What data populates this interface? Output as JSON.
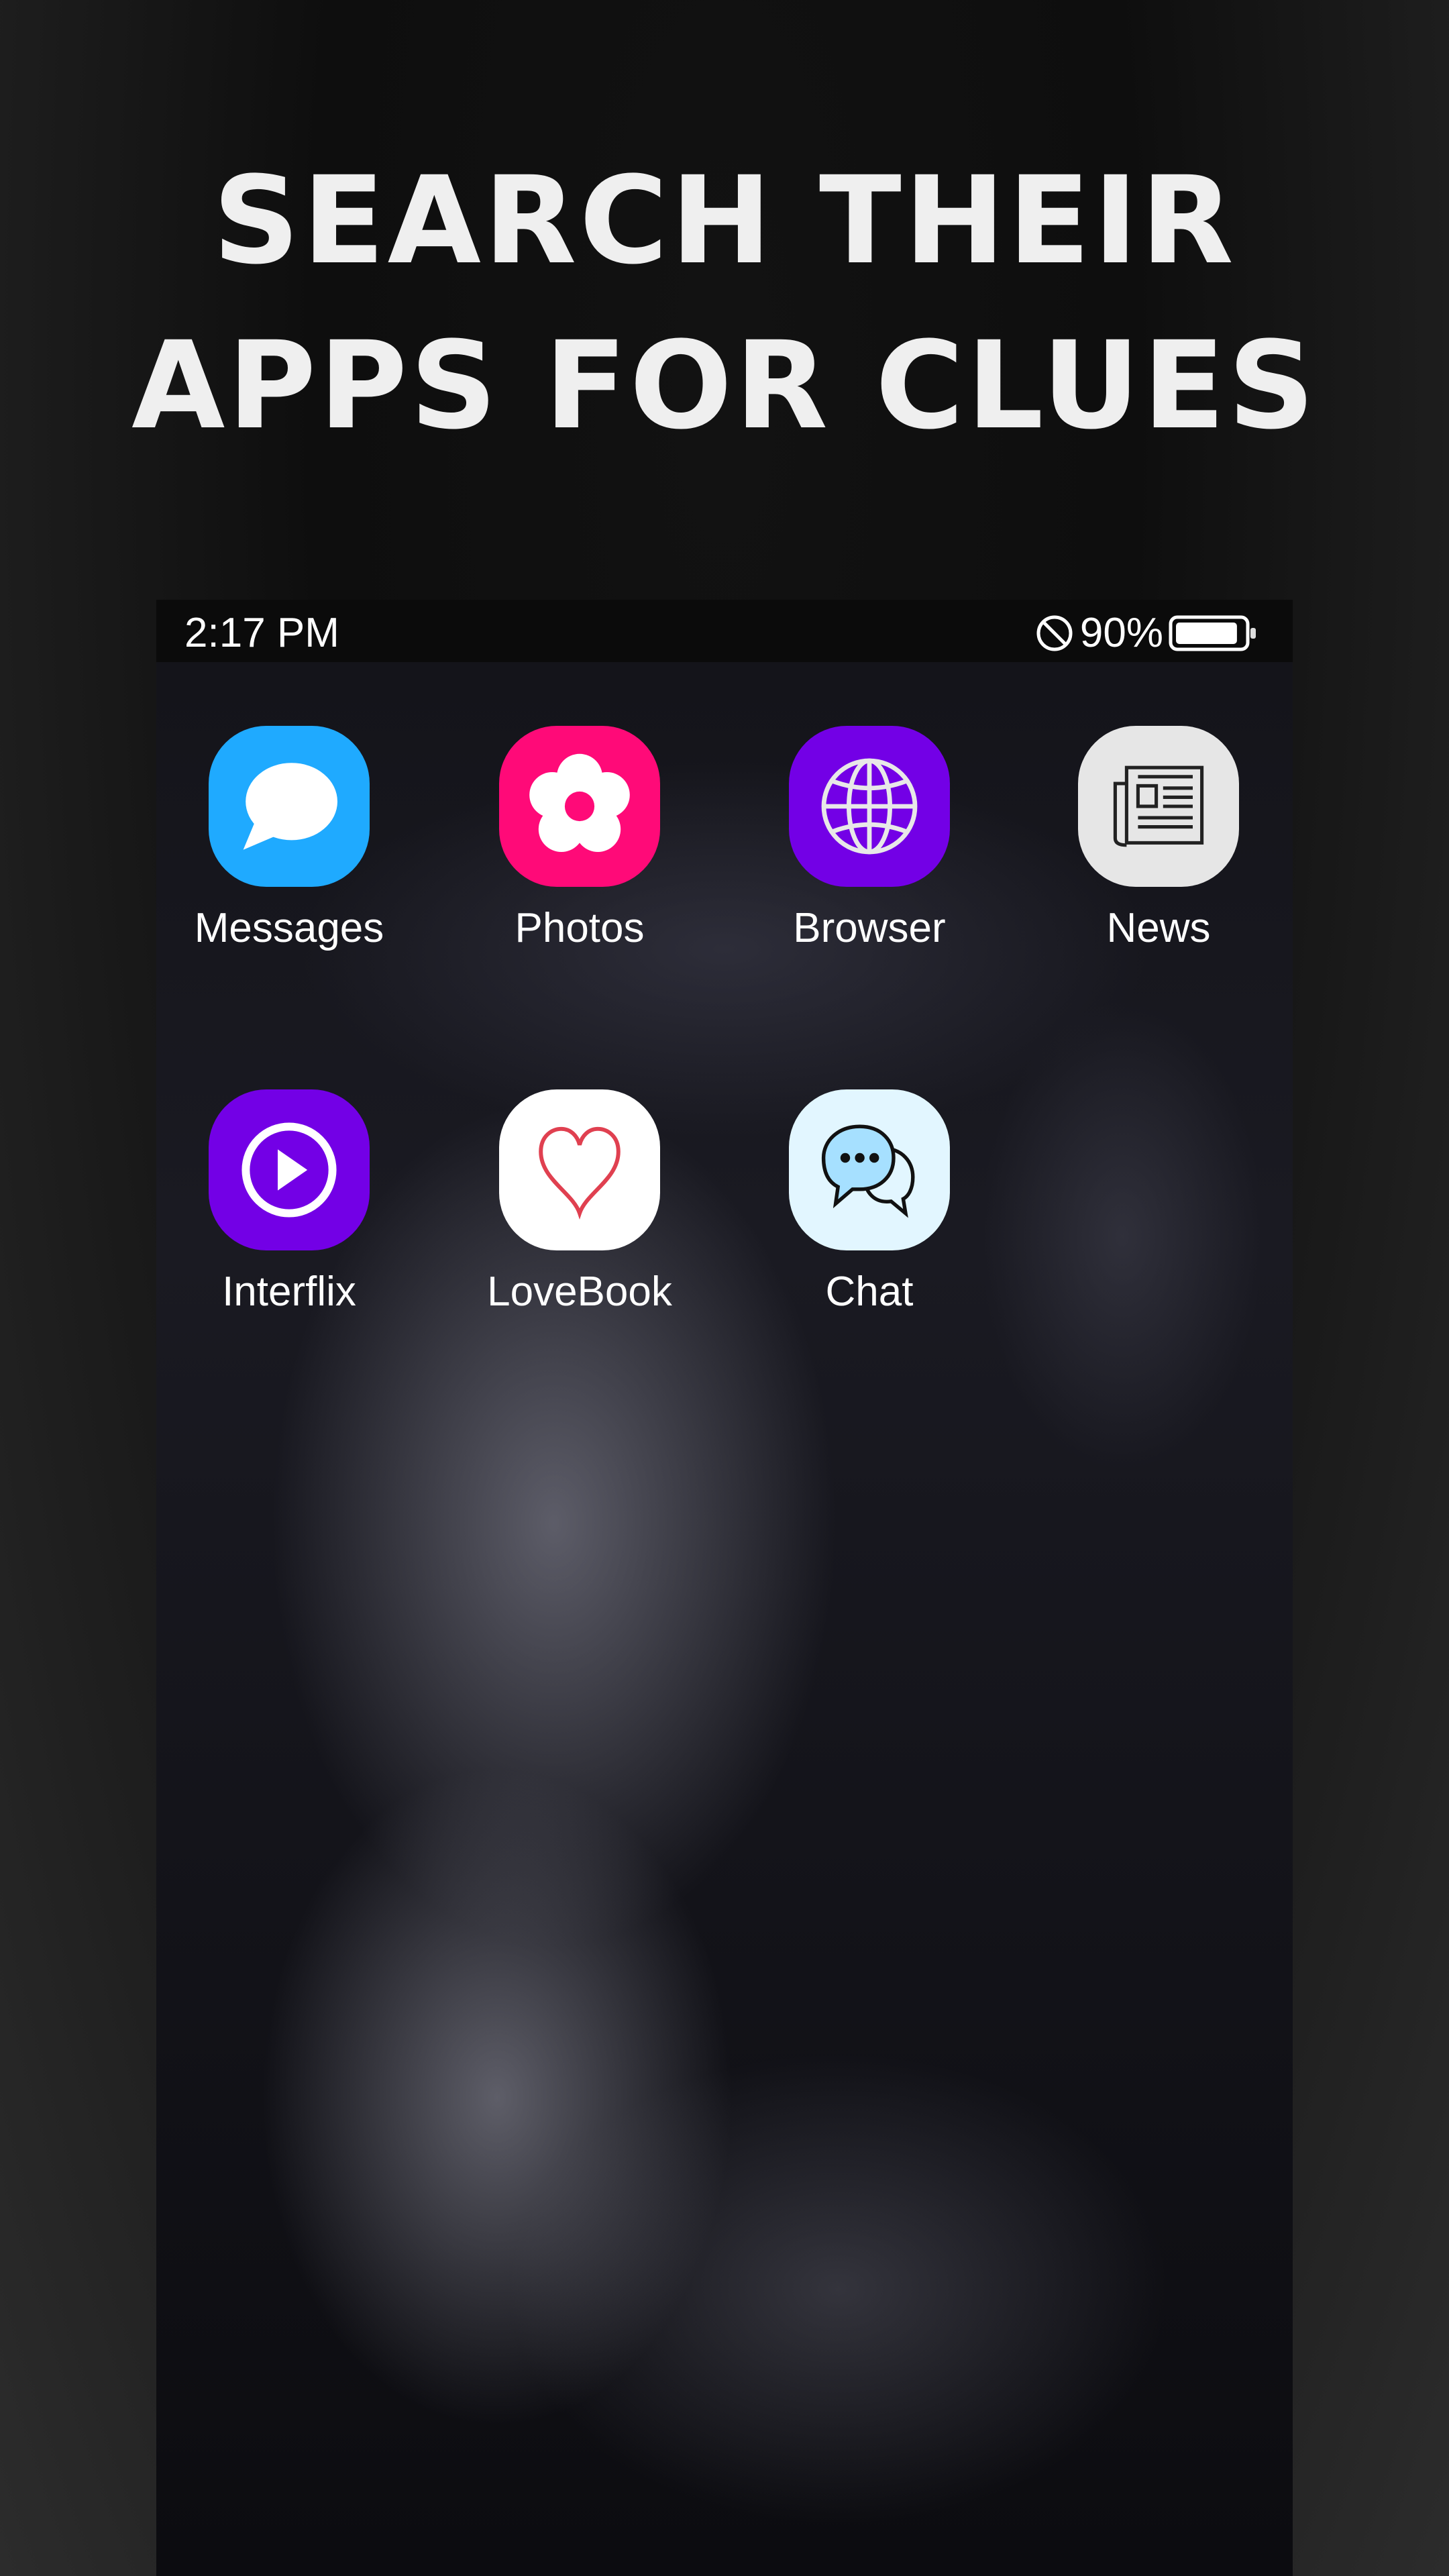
{
  "headline": {
    "line1": "SEARCH THEIR",
    "line2": "APPS FOR CLUES"
  },
  "status_bar": {
    "time": "2:17 PM",
    "battery_percent": "90%",
    "battery_level": 0.9,
    "dnd_icon": "do-not-disturb-icon"
  },
  "apps": [
    {
      "label": "Messages",
      "icon": "speech-bubble-icon",
      "color": "#1faaff"
    },
    {
      "label": "Photos",
      "icon": "flower-icon",
      "color": "#ff0a78"
    },
    {
      "label": "Browser",
      "icon": "globe-icon",
      "color": "#7300e6"
    },
    {
      "label": "News",
      "icon": "newspaper-icon",
      "color": "#e6e6e6"
    },
    {
      "label": "Interflix",
      "icon": "play-circle-icon",
      "color": "#7300e6"
    },
    {
      "label": "LoveBook",
      "icon": "heart-icon",
      "color": "#ffffff"
    },
    {
      "label": "Chat",
      "icon": "chat-bubbles-icon",
      "color": "#e2f6ff"
    }
  ]
}
